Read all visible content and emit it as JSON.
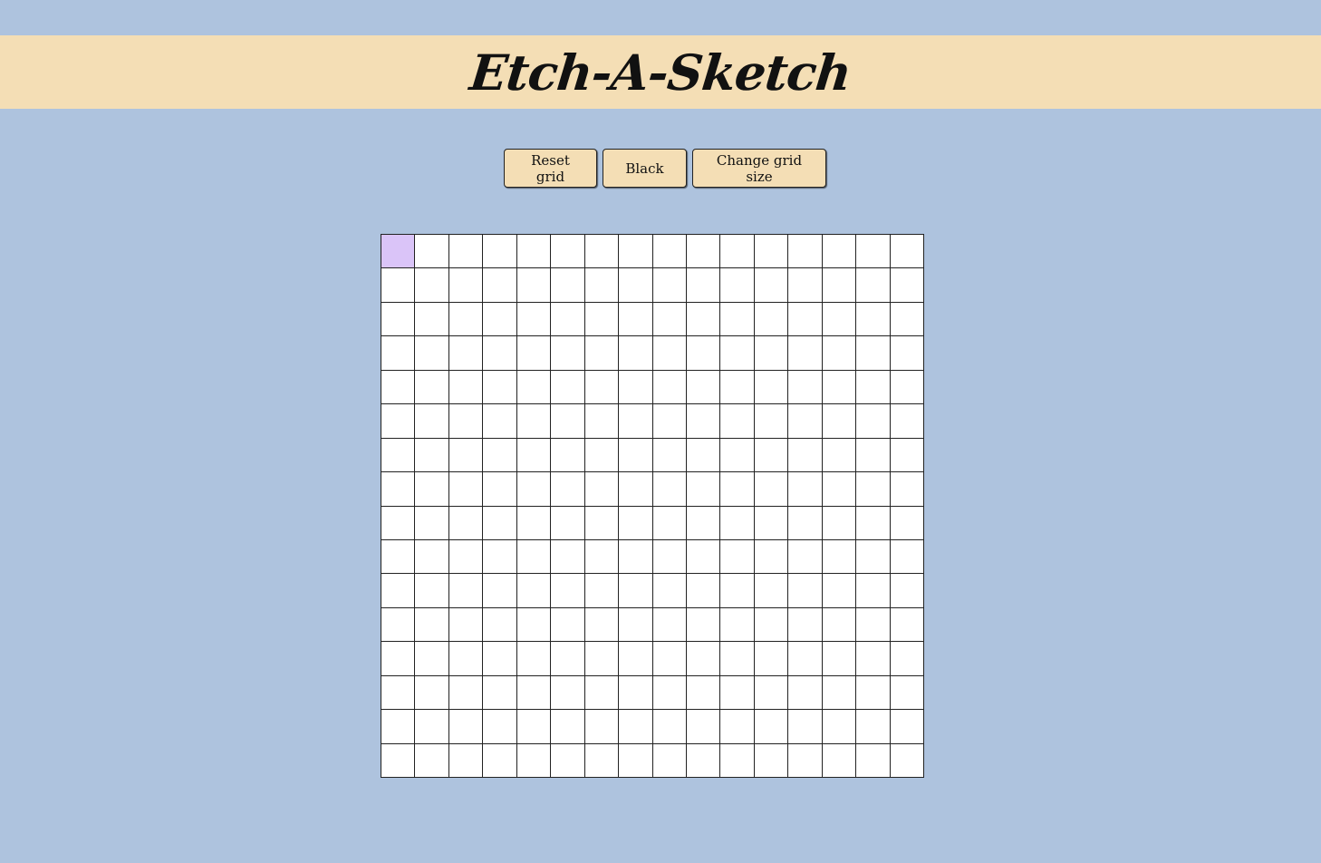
{
  "header": {
    "title": "Etch-A-Sketch"
  },
  "controls": {
    "reset_label": "Reset grid",
    "color_label": "Black",
    "size_label": "Change grid size"
  },
  "grid": {
    "rows": 16,
    "columns": 16,
    "cell_color": "#ffffff",
    "line_color": "#222222",
    "painted_cells": [
      {
        "row": 0,
        "col": 0,
        "color": "#dac4f8"
      }
    ]
  },
  "colors": {
    "background": "#aec3de",
    "header_background": "#f4deb5",
    "button_background": "#f4deb5"
  }
}
